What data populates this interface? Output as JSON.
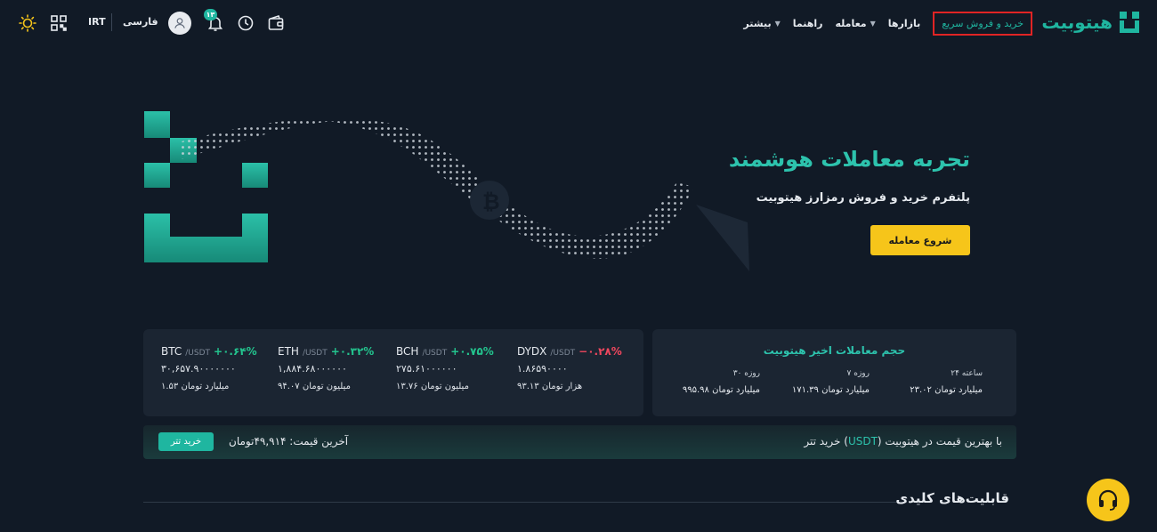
{
  "header": {
    "logo_text": "هیتوبیت",
    "nav": [
      {
        "label": "خرید و فروش سریع",
        "highlight": true,
        "caret": false
      },
      {
        "label": "بازارها",
        "caret": false
      },
      {
        "label": "معامله",
        "caret": true
      },
      {
        "label": "راهنما",
        "caret": false
      },
      {
        "label": "بیشتر",
        "caret": true
      }
    ],
    "currency": "IRT",
    "language": "فارسی",
    "notification_count": "۱۳",
    "icons": [
      "sun-icon",
      "qr-code-icon",
      "user-icon",
      "bell-icon",
      "history-icon",
      "wallet-icon"
    ]
  },
  "hero": {
    "title": "تجربه معاملات هوشمند",
    "subtitle": "پلتفرم خرید و فروش رمزارز هیتوبیت",
    "cta": "شروع معامله"
  },
  "tickers": [
    {
      "symbol": "BTC",
      "pair": "/USDT",
      "change": "+۰.۶۴%",
      "direction": "up",
      "price": "۳۰,۶۵۷.۹۰۰۰۰۰۰۰",
      "volume": "۱.۵۳ میلیارد تومان"
    },
    {
      "symbol": "ETH",
      "pair": "/USDT",
      "change": "+۰.۳۲%",
      "direction": "up",
      "price": "۱,۸۸۴.۶۸۰۰۰۰۰۰",
      "volume": "۹۴.۰۷ میلیون تومان"
    },
    {
      "symbol": "BCH",
      "pair": "/USDT",
      "change": "+۰.۷۵%",
      "direction": "up",
      "price": "۲۷۵.۶۱۰۰۰۰۰۰",
      "volume": "۱۳.۷۶ میلیون تومان"
    },
    {
      "symbol": "DYDX",
      "pair": "/USDT",
      "change": "−۰.۲۸%",
      "direction": "down",
      "price": "۱.۸۶۵۹۰۰۰۰",
      "volume": "۹۳.۱۳ هزار تومان"
    }
  ],
  "volume_card": {
    "title": "حجم معاملات اخیر هیتوبیت",
    "columns": [
      {
        "label": "۲۴ ساعته",
        "value": "۲۳.۰۲ میلیارد تومان"
      },
      {
        "label": "۷ روزه",
        "value": "۱۷۱.۳۹ میلیارد تومان"
      },
      {
        "label": "۳۰ روزه",
        "value": "۹۹۵.۹۸ میلیارد تومان"
      }
    ]
  },
  "promo": {
    "text_before": "خرید تتر (",
    "text_highlight": "USDT",
    "text_after": ") با بهترین قیمت در هیتوبیت",
    "last_price": "آخرین قیمت: ۴۹,۹۱۴تومان",
    "button": "خرید تتر"
  },
  "section": {
    "title": "قابلیت‌های کلیدی"
  },
  "colors": {
    "background": "#111a26",
    "card": "#1b2532",
    "accent": "#1fb6a0",
    "cta": "#f6c51a",
    "up": "#23c48e",
    "down": "#f0475e"
  }
}
